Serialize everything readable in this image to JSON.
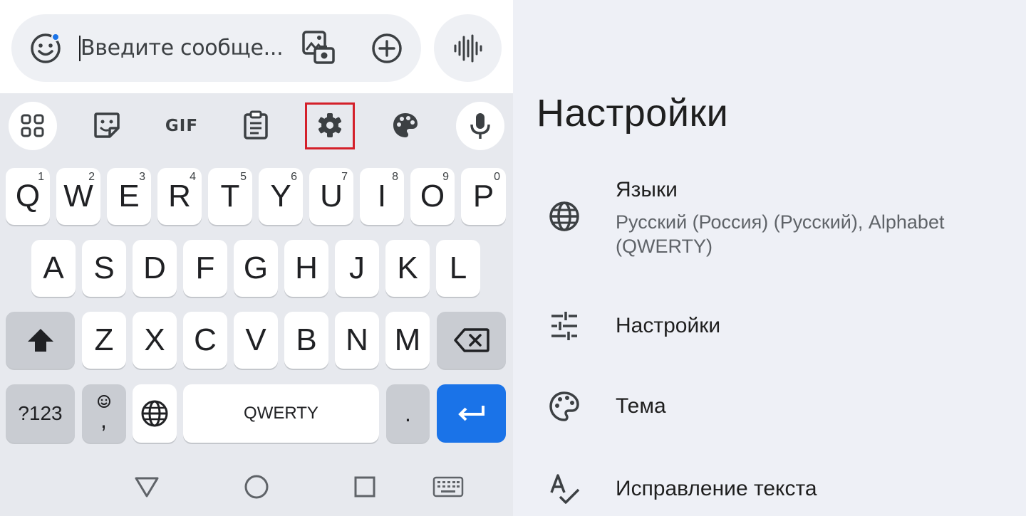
{
  "compose": {
    "placeholder": "Введите сообще..."
  },
  "toolbar": {
    "items": [
      "apps-grid-icon",
      "sticker-icon",
      "gif-icon",
      "clipboard-icon",
      "settings-gear-icon",
      "palette-icon",
      "mic-icon"
    ],
    "gif_label": "GIF"
  },
  "keyboard": {
    "row1": [
      {
        "key": "Q",
        "hint": "1"
      },
      {
        "key": "W",
        "hint": "2"
      },
      {
        "key": "E",
        "hint": "3"
      },
      {
        "key": "R",
        "hint": "4"
      },
      {
        "key": "T",
        "hint": "5"
      },
      {
        "key": "Y",
        "hint": "6"
      },
      {
        "key": "U",
        "hint": "7"
      },
      {
        "key": "I",
        "hint": "8"
      },
      {
        "key": "O",
        "hint": "9"
      },
      {
        "key": "P",
        "hint": "0"
      }
    ],
    "row2": [
      "A",
      "S",
      "D",
      "F",
      "G",
      "H",
      "J",
      "K",
      "L"
    ],
    "row3": [
      "Z",
      "X",
      "C",
      "V",
      "B",
      "N",
      "M"
    ],
    "symbols_label": "?123",
    "comma_label": ",",
    "space_label": "QWERTY",
    "period_label": "."
  },
  "settings": {
    "title": "Настройки",
    "items": [
      {
        "label": "Языки",
        "sub": "Русский (Россия) (Русский), Alphabet (QWERTY)",
        "icon": "globe-icon"
      },
      {
        "label": "Настройки",
        "icon": "tune-sliders-icon"
      },
      {
        "label": "Тема",
        "icon": "palette-icon"
      },
      {
        "label": "Исправление текста",
        "icon": "spellcheck-icon"
      }
    ]
  },
  "colors": {
    "accent": "#1a73e8",
    "highlight": "#d4202a"
  }
}
